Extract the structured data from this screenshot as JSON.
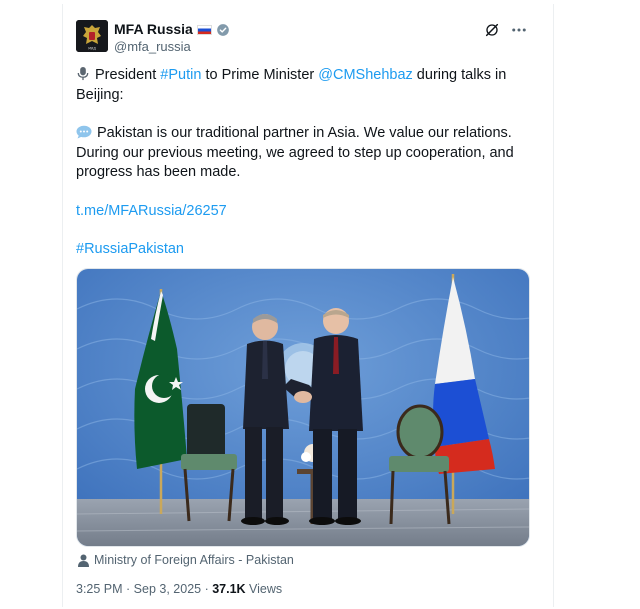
{
  "account": {
    "display_name": "MFA Russia",
    "handle": "@mfa_russia",
    "flag_icon": "russia-flag-icon",
    "verified_icon": "verified-badge-icon"
  },
  "post": {
    "line1_prefix": "President ",
    "hashtag_putin": "#Putin",
    "line1_middle": " to Prime Minister ",
    "mention": "@CMShehbaz",
    "line1_suffix": " during talks in Beijing:",
    "quote": "Pakistan is our traditional partner in Asia. We value our relations. During our previous meeting, we agreed to step up cooperation, and progress has been made.",
    "link": "t.me/MFARussia/26257",
    "hashtag": "#RussiaPakistan"
  },
  "media": {
    "credit": "Ministry of Foreign Affairs - Pakistan"
  },
  "meta": {
    "time": "3:25 PM",
    "separator": " · ",
    "date": "Sep 3, 2025",
    "views_count": "37.1K",
    "views_label": " Views"
  },
  "colors": {
    "link": "#1d9bf0",
    "muted": "#536471",
    "text": "#0f1419"
  }
}
